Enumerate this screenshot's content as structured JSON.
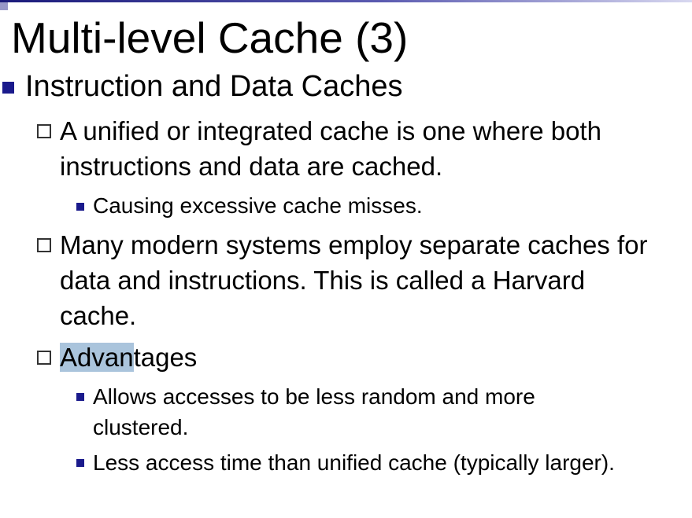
{
  "slide": {
    "title": "Multi-level Cache (3)",
    "heading": "Instruction and Data Caches",
    "points": [
      {
        "text": "A unified or integrated cache is one where both instructions and data are cached.",
        "subpoints": [
          "Causing excessive cache misses."
        ]
      },
      {
        "text": "Many modern systems employ separate caches for data and instructions. This is called a Harvard cache.",
        "subpoints": []
      },
      {
        "text_selected": "Advan",
        "text_rest": "tages",
        "subpoints": [
          "Allows accesses to be less random and more clustered.",
          "Less access time than unified cache (typically larger)."
        ]
      }
    ]
  },
  "colors": {
    "bullet_fill": "#1a1a8c",
    "selection_highlight": "#aac4dc",
    "top_rule": "#1a1a7a"
  },
  "icons": {
    "level1_bullet": "filled-square",
    "level2_bullet": "hollow-square",
    "level3_bullet": "filled-small-square"
  }
}
